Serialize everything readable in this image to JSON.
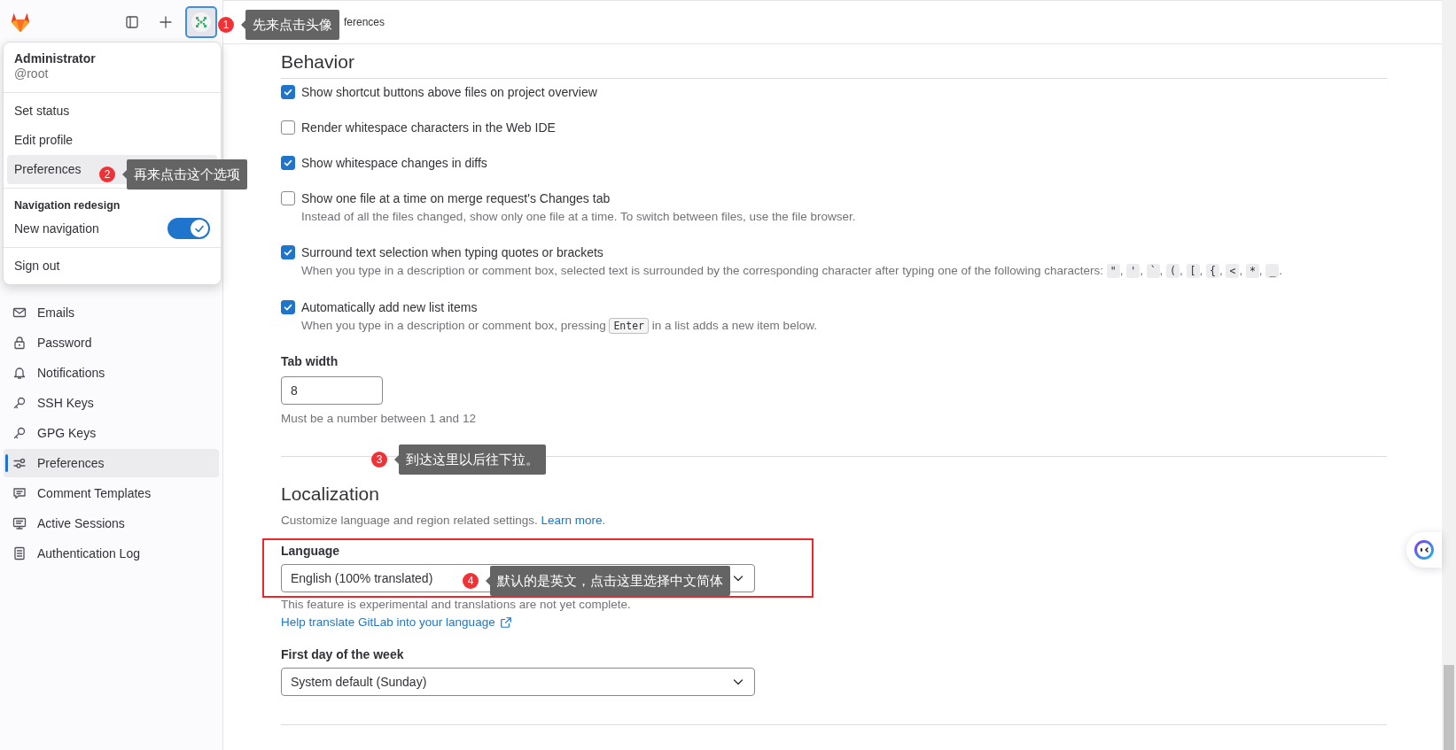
{
  "sidebar": {
    "items": [
      {
        "label": "Emails",
        "selected": false
      },
      {
        "label": "Password",
        "selected": false
      },
      {
        "label": "Notifications",
        "selected": false
      },
      {
        "label": "SSH Keys",
        "selected": false
      },
      {
        "label": "GPG Keys",
        "selected": false
      },
      {
        "label": "Preferences",
        "selected": true
      },
      {
        "label": "Comment Templates",
        "selected": false
      },
      {
        "label": "Active Sessions",
        "selected": false
      },
      {
        "label": "Authentication Log",
        "selected": false
      }
    ]
  },
  "user_menu": {
    "name": "Administrator",
    "username": "@root",
    "items": [
      {
        "label": "Set status",
        "selected": false
      },
      {
        "label": "Edit profile",
        "selected": false
      },
      {
        "label": "Preferences",
        "selected": true
      }
    ],
    "section_title": "Navigation redesign",
    "toggle": {
      "label": "New navigation",
      "on": true
    },
    "sign_out": "Sign out"
  },
  "breadcrumb": "ferences",
  "behavior": {
    "title": "Behavior",
    "options": [
      {
        "label": "Show shortcut buttons above files on project overview",
        "checked": true
      },
      {
        "label": "Render whitespace characters in the Web IDE",
        "checked": false
      },
      {
        "label": "Show whitespace changes in diffs",
        "checked": true
      },
      {
        "label": "Show one file at a time on merge request's Changes tab",
        "checked": false,
        "help": [
          {
            "kind": "text",
            "text": "Instead of all the files changed, show only one file at a time. To switch between files, use the file browser."
          }
        ]
      },
      {
        "label": "Surround text selection when typing quotes or brackets",
        "checked": true,
        "help": [
          {
            "kind": "text",
            "text": "When you type in a description or comment box, selected text is surrounded by the corresponding character after typing one of the following characters: "
          },
          {
            "kind": "code",
            "text": "\""
          },
          {
            "kind": "text",
            "text": ", "
          },
          {
            "kind": "code",
            "text": "'"
          },
          {
            "kind": "text",
            "text": ", "
          },
          {
            "kind": "code",
            "text": "`"
          },
          {
            "kind": "text",
            "text": ", "
          },
          {
            "kind": "code",
            "text": "("
          },
          {
            "kind": "text",
            "text": ", "
          },
          {
            "kind": "code",
            "text": "["
          },
          {
            "kind": "text",
            "text": ", "
          },
          {
            "kind": "code",
            "text": "{"
          },
          {
            "kind": "text",
            "text": ", "
          },
          {
            "kind": "code",
            "text": "<"
          },
          {
            "kind": "text",
            "text": ", "
          },
          {
            "kind": "code",
            "text": "*"
          },
          {
            "kind": "text",
            "text": ", "
          },
          {
            "kind": "code",
            "text": "_"
          },
          {
            "kind": "text",
            "text": "."
          }
        ]
      },
      {
        "label": "Automatically add new list items",
        "checked": true,
        "help": [
          {
            "kind": "text",
            "text": "When you type in a description or comment box, pressing "
          },
          {
            "kind": "code",
            "text": "Enter"
          },
          {
            "kind": "text",
            "text": " in a list adds a new item below."
          }
        ]
      }
    ],
    "tab_width": {
      "label": "Tab width",
      "value": "8",
      "help": "Must be a number between 1 and 12"
    }
  },
  "localization": {
    "title": "Localization",
    "description": "Customize language and region related settings. ",
    "learn_more": "Learn more",
    "description_end": ".",
    "language": {
      "label": "Language",
      "value": "English (100% translated)",
      "note": "This feature is experimental and translations are not yet complete.",
      "help_link": "Help translate GitLab into your language"
    },
    "first_day": {
      "label": "First day of the week",
      "value": "System default (Sunday)"
    }
  },
  "annotations": [
    {
      "number": "1",
      "text": "先来点击头像"
    },
    {
      "number": "2",
      "text": "再来点击这个选项"
    },
    {
      "number": "3",
      "text": "到达这里以后往下拉。"
    },
    {
      "number": "4",
      "text": "默认的是英文，点击这里选择中文简体"
    }
  ]
}
